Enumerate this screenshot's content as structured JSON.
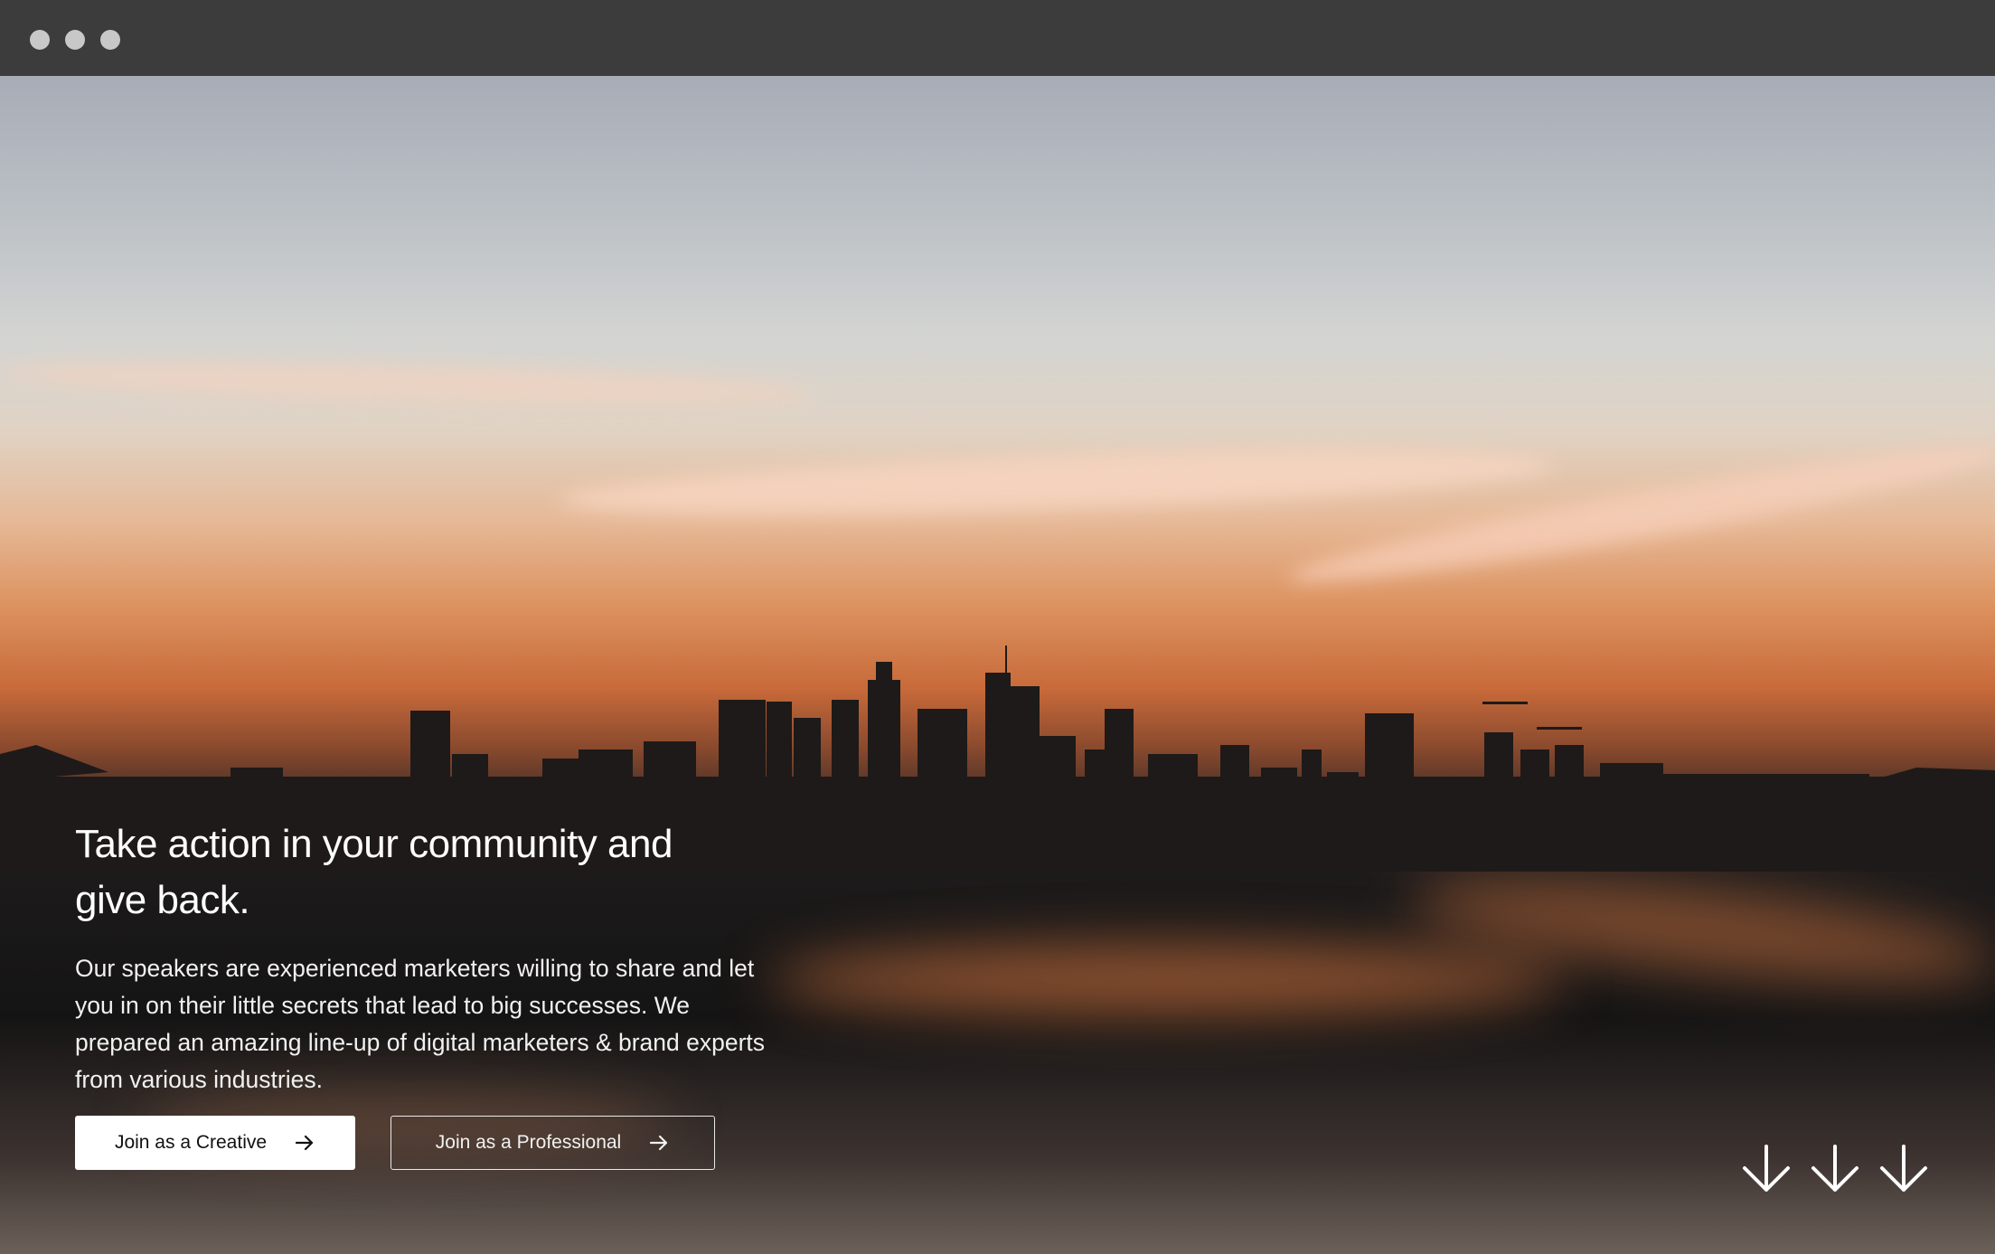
{
  "window": {
    "controls": [
      "close",
      "minimize",
      "maximize"
    ]
  },
  "hero": {
    "headline": "Take action in your community and give back.",
    "description": "Our speakers are experienced marketers willing to share and let you in on their little secrets that lead to big successes. We prepared an amazing line-up of digital marketers & brand experts from various industries.",
    "buttons": [
      {
        "label": "Join as a Creative",
        "icon": "arrow-right-icon",
        "style": "filled"
      },
      {
        "label": "Join as a Professional",
        "icon": "arrow-right-icon",
        "style": "outline"
      }
    ],
    "scroll_indicator": {
      "icon": "arrow-down-icon",
      "count": 3
    }
  },
  "colors": {
    "titlebar": "#3c3c3c",
    "window_dot": "#c8c8c8",
    "text": "#ffffff",
    "button_filled_bg": "#ffffff",
    "button_filled_text": "#111111"
  }
}
